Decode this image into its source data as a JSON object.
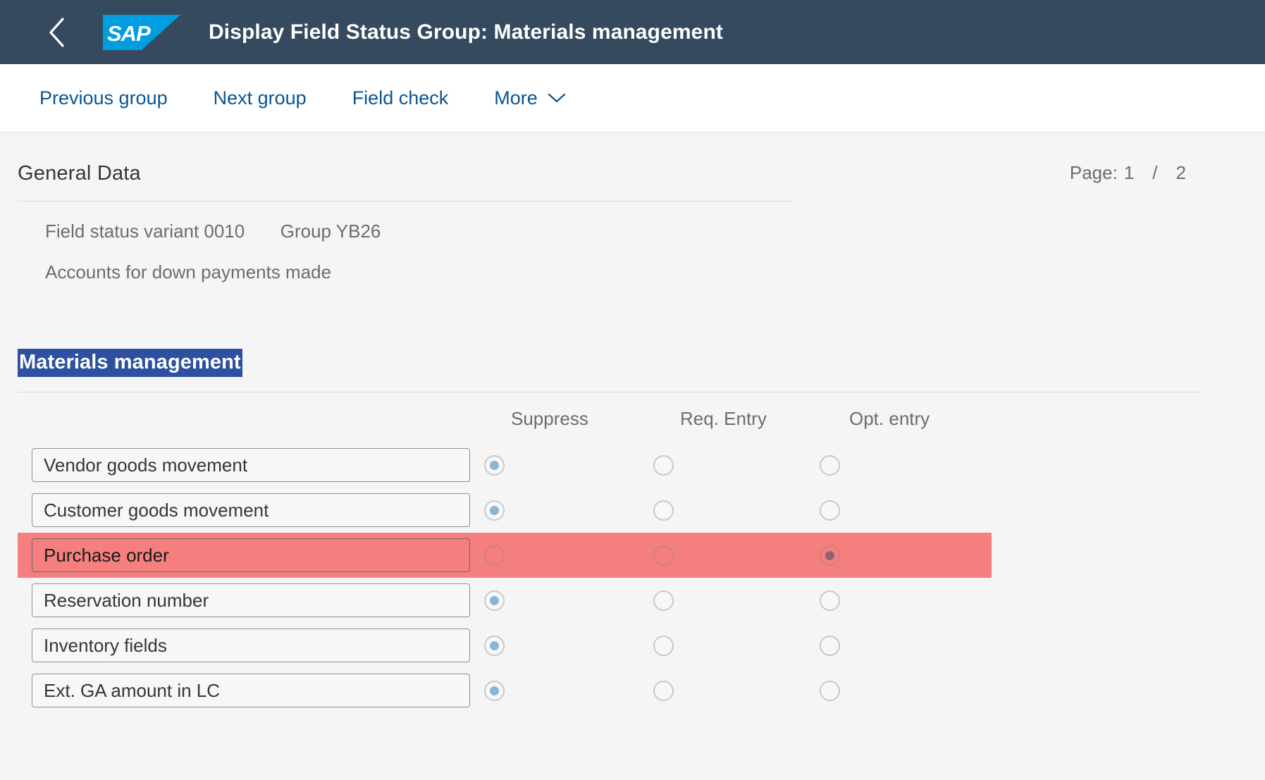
{
  "shell": {
    "back_icon": "chevron-left-icon",
    "logo_text": "SAP",
    "logo_color": "#009de0",
    "title": "Display Field Status Group: Materials management",
    "bar_color": "#354a5f"
  },
  "toolbar": {
    "items": [
      {
        "label": "Previous group",
        "has_chevron": false
      },
      {
        "label": "Next group",
        "has_chevron": false
      },
      {
        "label": "Field check",
        "has_chevron": false
      },
      {
        "label": "More",
        "has_chevron": true
      }
    ],
    "link_color": "#0a5591"
  },
  "general_data": {
    "section_title": "General Data",
    "variant_label": "Field status variant 0010",
    "group_label": "Group YB26",
    "description": "Accounts for down payments made"
  },
  "pagination": {
    "label": "Page:",
    "current": "1",
    "separator": "/",
    "total": "2"
  },
  "materials_management": {
    "heading": "Materials management",
    "heading_selected": true,
    "selection_color": "#2d51a0",
    "columns": [
      "Suppress",
      "Req. Entry",
      "Opt. entry"
    ],
    "highlight_color": "#f57f7f",
    "rows": [
      {
        "label": "Vendor goods movement",
        "selected": "Suppress",
        "highlighted": false
      },
      {
        "label": "Customer goods movement",
        "selected": "Suppress",
        "highlighted": false
      },
      {
        "label": "Purchase order",
        "selected": "Opt. entry",
        "highlighted": true
      },
      {
        "label": "Reservation number",
        "selected": "Suppress",
        "highlighted": false
      },
      {
        "label": "Inventory fields",
        "selected": "Suppress",
        "highlighted": false
      },
      {
        "label": "Ext. GA amount in LC",
        "selected": "Suppress",
        "highlighted": false
      }
    ]
  }
}
